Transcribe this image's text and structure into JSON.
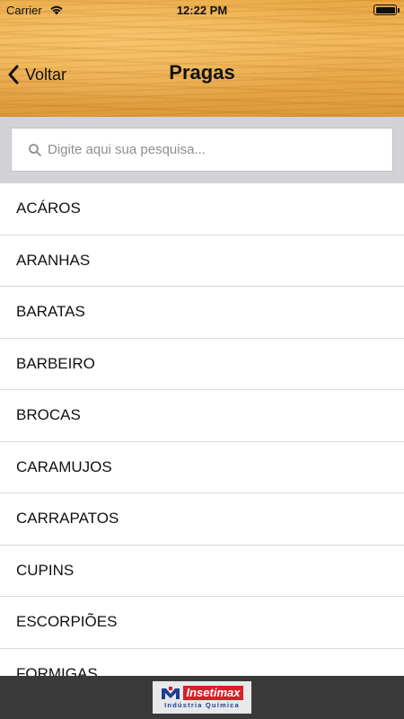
{
  "status_bar": {
    "carrier": "Carrier",
    "time": "12:22 PM",
    "battery_level": 1.0
  },
  "nav": {
    "back_label": "Voltar",
    "title": "Pragas"
  },
  "search": {
    "placeholder": "Digite aqui sua pesquisa...",
    "value": ""
  },
  "list": {
    "items": [
      "ACÁROS",
      "ARANHAS",
      "BARATAS",
      "BARBEIRO",
      "BROCAS",
      "CARAMUJOS",
      "CARRAPATOS",
      "CUPINS",
      "ESCORPIÕES",
      "FORMIGAS"
    ]
  },
  "footer": {
    "brand_name": "Insetimax",
    "brand_tagline": "Indústria Química"
  },
  "colors": {
    "header_wood": "#e9a844",
    "search_bg": "#d2d2d7",
    "footer_bg": "#3a3a3a",
    "brand_red": "#d5202a",
    "brand_blue": "#1d3f8f"
  },
  "icons": {
    "back": "chevron-left-icon",
    "search": "search-icon",
    "wifi": "wifi-icon",
    "battery": "battery-icon"
  }
}
